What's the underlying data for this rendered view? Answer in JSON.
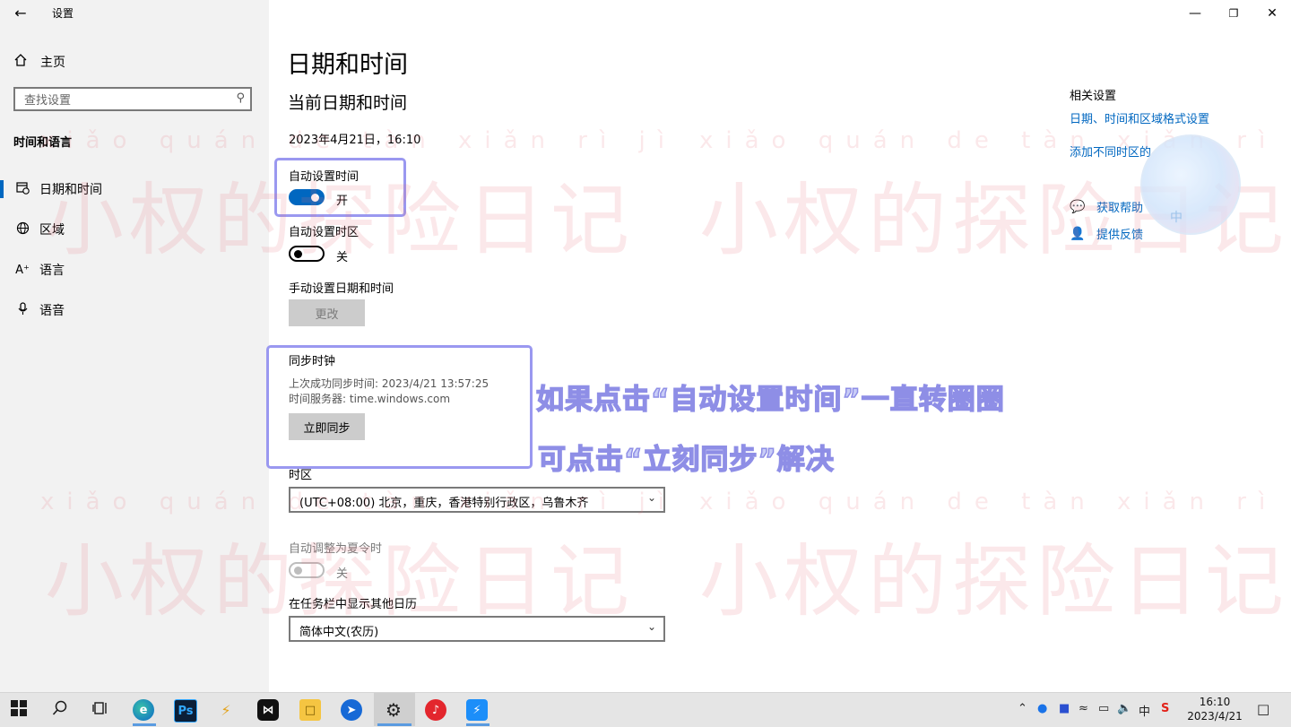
{
  "window": {
    "title": "设置",
    "back_icon": "arrow-left-icon"
  },
  "caption_buttons": [
    "minimize-icon",
    "restore-icon",
    "close-icon"
  ],
  "sidebar": {
    "home_label": "主页",
    "search_placeholder": "查找设置",
    "section": "时间和语言",
    "items": [
      {
        "label": "日期和时间",
        "icon": "calendar-clock-icon",
        "active": true
      },
      {
        "label": "区域",
        "icon": "globe-icon",
        "active": false
      },
      {
        "label": "语言",
        "icon": "language-icon",
        "active": false
      },
      {
        "label": "语音",
        "icon": "microphone-icon",
        "active": false
      }
    ]
  },
  "main": {
    "title": "日期和时间",
    "subtitle": "当前日期和时间",
    "current_datetime": "2023年4月21日，16:10",
    "auto_time": {
      "label": "自动设置时间",
      "state": "开",
      "on": true
    },
    "auto_timezone": {
      "label": "自动设置时区",
      "state": "关",
      "on": false
    },
    "manual": {
      "label": "手动设置日期和时间",
      "button": "更改"
    },
    "sync": {
      "label": "同步时钟",
      "last_sync": "上次成功同步时间: 2023/4/21 13:57:25",
      "server": "时间服务器: time.windows.com",
      "button": "立即同步"
    },
    "timezone": {
      "label": "时区",
      "value": "(UTC+08:00) 北京，重庆，香港特别行政区，乌鲁木齐"
    },
    "dst": {
      "label": "自动调整为夏令时",
      "state": "关"
    },
    "calendar": {
      "label": "在任务栏中显示其他日历",
      "value": "简体中文(农历)"
    }
  },
  "related": {
    "title": "相关设置",
    "links": [
      "日期、时间和区域格式设置",
      "添加不同时区的"
    ],
    "help": [
      {
        "label": "获取帮助",
        "icon": "help-chat-icon"
      },
      {
        "label": "提供反馈",
        "icon": "feedback-icon"
      }
    ]
  },
  "overlay": {
    "caption_line1": "如果点击“自动设置时间”一直转圈圈",
    "caption_line2": "可点击“立刻同步”解决",
    "watermark": "小权的探险日记",
    "watermark_pinyin": "xiǎo quán de tàn xiǎn rì jì",
    "logo_text": "中"
  },
  "taskbar": {
    "ps_label": "Ps",
    "tray_ime": "中",
    "time": "16:10",
    "date": "2023/4/21"
  },
  "colors": {
    "accent": "#0067c0",
    "highlight_border": "#9a98f0",
    "sidebar_bg": "#f2f2f2",
    "taskbar_bg": "#e5e5e5"
  }
}
